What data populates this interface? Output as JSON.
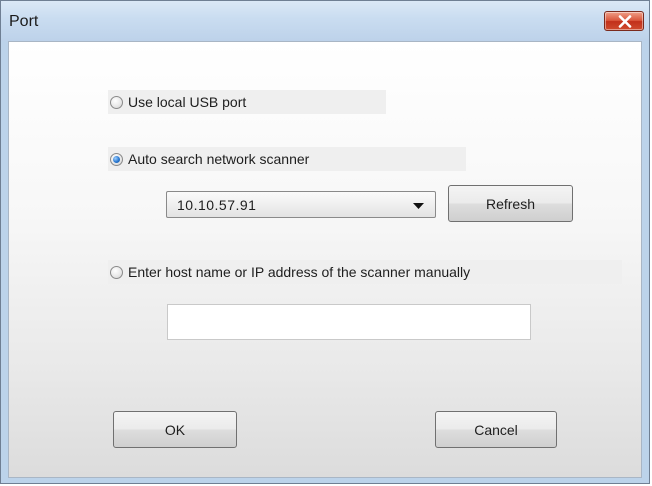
{
  "window": {
    "title": "Port"
  },
  "options": {
    "usb_label": "Use local USB port",
    "auto_label": "Auto search network scanner",
    "manual_label": "Enter host name or IP address of the scanner manually",
    "selected": "auto"
  },
  "scanner_select": {
    "value": "10.10.57.91"
  },
  "manual_host": {
    "value": ""
  },
  "buttons": {
    "refresh": "Refresh",
    "ok": "OK",
    "cancel": "Cancel"
  },
  "colors": {
    "title_bar": "#c9dcf0",
    "close_button": "#c7381f",
    "radio_selected": "#2a78d0"
  }
}
